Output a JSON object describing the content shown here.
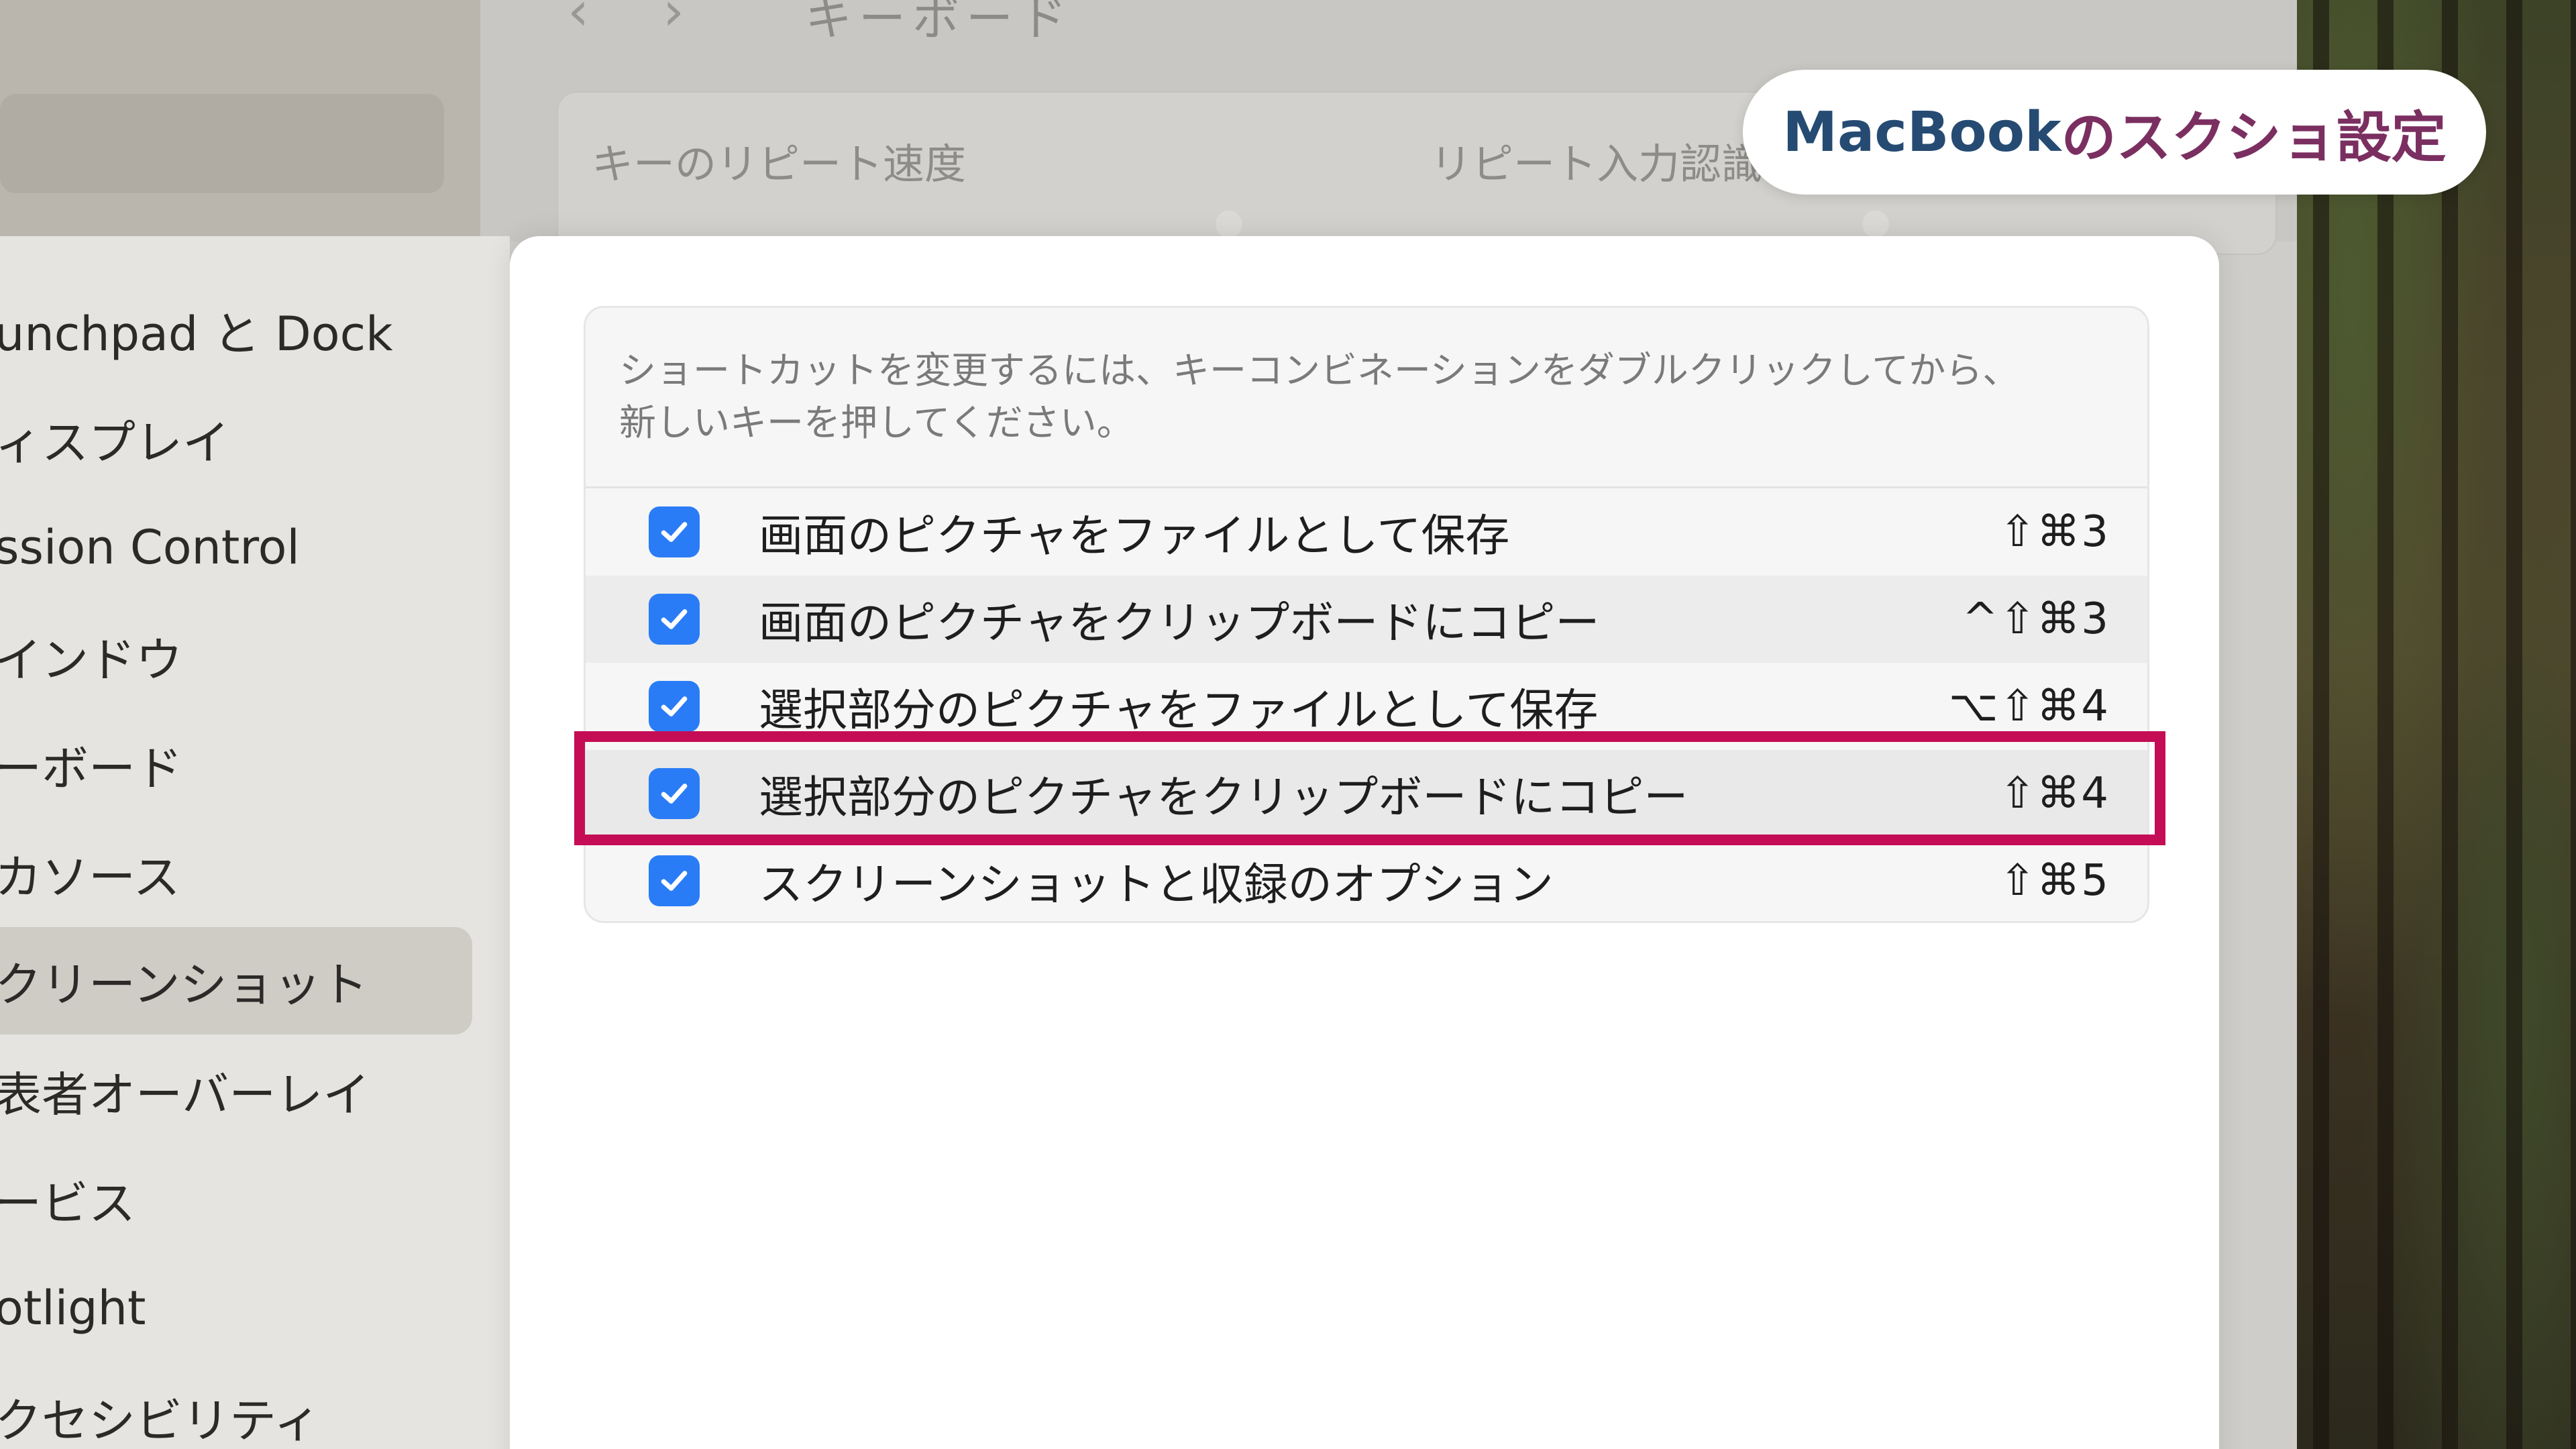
{
  "colors": {
    "accent_checkbox": "#2a7cf6",
    "highlight_frame": "#c40d55",
    "caption_primary": "#264b73",
    "caption_secondary": "#7b2f61"
  },
  "background_window": {
    "nav_back_icon": "chevron-left-icon",
    "nav_forward_icon": "chevron-right-icon",
    "title": "キーボード",
    "key_repeat_label": "キーのリピート速度",
    "repeat_delay_label": "リピート入力認識"
  },
  "caption": {
    "part_a": "MacBook",
    "part_b": "のスクショ設定"
  },
  "sidebar": {
    "items": [
      {
        "label": "unchpad と Dock",
        "selected": false
      },
      {
        "label": "ィスプレイ",
        "selected": false
      },
      {
        "label": "ssion Control",
        "selected": false
      },
      {
        "label": "インドウ",
        "selected": false
      },
      {
        "label": "ーボード",
        "selected": false
      },
      {
        "label": "カソース",
        "selected": false
      },
      {
        "label": "クリーンショット",
        "selected": true
      },
      {
        "label": "表者オーバーレイ",
        "selected": false
      },
      {
        "label": "ービス",
        "selected": false
      },
      {
        "label": "otlight",
        "selected": false
      },
      {
        "label": "クセシビリティ",
        "selected": false
      }
    ]
  },
  "shortcuts": {
    "description_line1": "ショートカットを変更するには、キーコンビネーションをダブルクリックしてから、",
    "description_line2": "新しいキーを押してください。",
    "rows": [
      {
        "label": "画面のピクチャをファイルとして保存",
        "keys": "⇧⌘3",
        "checked": true
      },
      {
        "label": "画面のピクチャをクリップボードにコピー",
        "keys": "^⇧⌘3",
        "checked": true
      },
      {
        "label": "選択部分のピクチャをファイルとして保存",
        "keys": "⌥⇧⌘4",
        "checked": true
      },
      {
        "label": "選択部分のピクチャをクリップボードにコピー",
        "keys": "⇧⌘4",
        "checked": true,
        "highlighted": true
      },
      {
        "label": "スクリーンショットと収録のオプション",
        "keys": "⇧⌘5",
        "checked": true
      }
    ]
  }
}
